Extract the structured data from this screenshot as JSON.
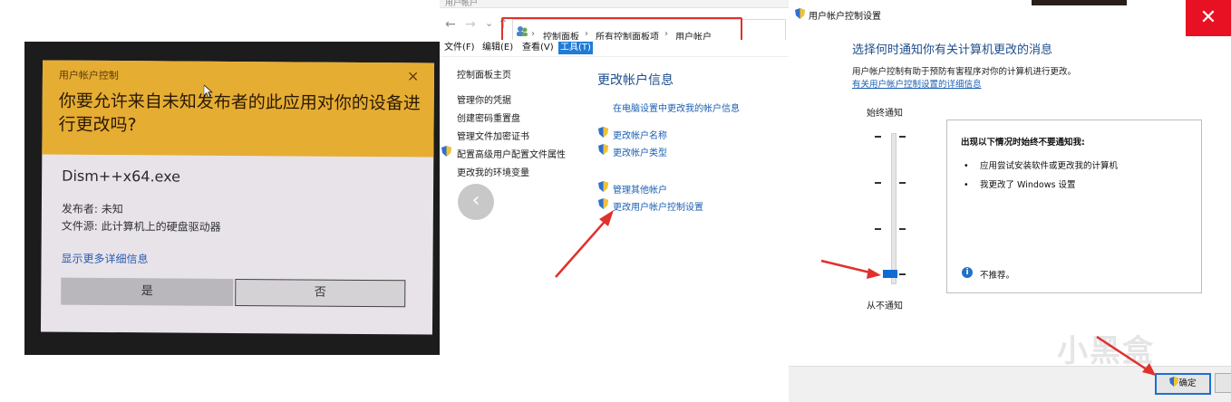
{
  "uac_prompt": {
    "title": "用户帐户控制",
    "close": "×",
    "question": "你要允许来自未知发布者的此应用对你的设备进行更改吗?",
    "app_name": "Dism++x64.exe",
    "publisher": "发布者: 未知",
    "file_source": "文件源: 此计算机上的硬盘驱动器",
    "more_details": "显示更多详细信息",
    "yes_label": "是",
    "no_label": "否"
  },
  "control_panel": {
    "window_title_fragment": "用户帐户",
    "nav": {
      "back": "←",
      "forward": "→",
      "recent": "⌄",
      "up": "↑"
    },
    "breadcrumb": [
      "控制面板",
      "所有控制面板项",
      "用户帐户"
    ],
    "breadcrumb_sep": "›",
    "menu": [
      "文件(F)",
      "编辑(E)",
      "查看(V)",
      "工具(T)"
    ],
    "left_links": [
      "控制面板主页",
      "管理你的凭据",
      "创建密码重置盘",
      "管理文件加密证书",
      "配置高级用户配置文件属性",
      "更改我的环境变量"
    ],
    "heading": "更改帐户信息",
    "right_links": [
      "在电脑设置中更改我的帐户信息",
      "更改帐户名称",
      "更改帐户类型",
      "管理其他帐户",
      "更改用户帐户控制设置"
    ],
    "back_circle": "‹"
  },
  "uac_settings": {
    "title": "用户帐户控制设置",
    "close": "✕",
    "heading": "选择何时通知你有关计算机更改的消息",
    "description": "用户帐户控制有助于预防有害程序对你的计算机进行更改。",
    "link": "有关用户帐户控制设置的详细信息",
    "always_notify": "始终通知",
    "never_notify": "从不通知",
    "box_title": "出现以下情况时始终不要通知我:",
    "bullets": [
      "应用尝试安装软件或更改我的计算机",
      "我更改了 Windows 设置"
    ],
    "bullet_char": "•",
    "not_recommended": "不推荐。",
    "info_glyph": "i",
    "ok_label": "确定",
    "slider_level": 0,
    "watermark": "小黑盒"
  },
  "colors": {
    "uac_banner": "#e6ad33",
    "link_blue": "#1a5fb4",
    "heading_blue": "#1e4e8c",
    "annotation_red": "#e0312d",
    "accent_blue": "#0f6cd6"
  }
}
